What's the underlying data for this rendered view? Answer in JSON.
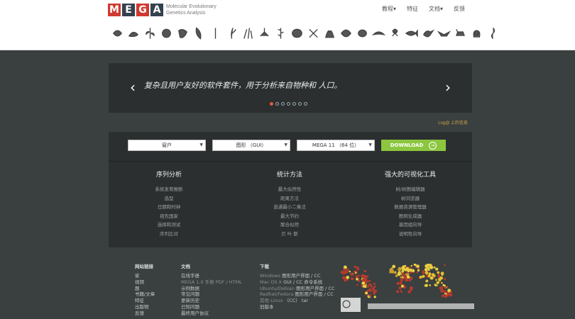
{
  "header": {
    "logo_letters": [
      "M",
      "E",
      "G",
      "A"
    ],
    "logo_subtitle_line1": "Molecular Evolutionary",
    "logo_subtitle_line2": "Genetics Analysis",
    "nav": [
      {
        "label": "教程",
        "has_dropdown": true
      },
      {
        "label": "特征",
        "has_dropdown": false
      },
      {
        "label": "文档",
        "has_dropdown": true
      },
      {
        "label": "反馈",
        "has_dropdown": false
      }
    ],
    "organism_icons": [
      "bacteria-icon",
      "worm-icon",
      "plant-icon",
      "virus-icon",
      "fungus-icon",
      "leaf-icon",
      "seed-icon",
      "sprout-icon",
      "grass-icon",
      "mosquito-icon",
      "wheat-icon",
      "cell-icon",
      "flower-icon",
      "coral-icon",
      "shell-icon",
      "protozoa-icon",
      "nematode-icon",
      "insect-icon",
      "fish-icon",
      "bird-icon",
      "bat-icon",
      "dog-icon",
      "monkey-icon",
      "seahorse-icon"
    ]
  },
  "hero": {
    "text": "复杂且用户友好的软件套件，用于分析来自物种和 人口。",
    "prev_arrow": "‹",
    "next_arrow": "›",
    "slide_count": 7,
    "active_slide": 1
  },
  "login_text": "Log@ 上的信息",
  "download": {
    "os_value": "窗户",
    "interface_value": "图形 （GUI）",
    "version_value": "MEGA 11 （64 位）",
    "button_label": "DOWNLOAD",
    "button_icon": "→"
  },
  "features": [
    {
      "title": "序列分析",
      "items": [
        "系统发育推断",
        "选型",
        "日期和时钟",
        "祖先国家",
        "选择和测试",
        "序列比对"
      ]
    },
    {
      "title": "统计方法",
      "items": [
        "最大似然性",
        "距离方法",
        "普通最小二乘法",
        "最大节约",
        "聚合似然",
        "贝 叶 斯"
      ]
    },
    {
      "title": "强大的可视化工具",
      "items": [
        "树/树图编辑器",
        "树浏览器",
        "数据资源管理器",
        "图例生成器",
        "基因组向导",
        "说明性向导"
      ]
    }
  ],
  "footer": {
    "links": {
      "title": "网站链接",
      "items": [
        "家",
        "视频",
        "题",
        "书籍/文章",
        "特征",
        "出版物",
        "反馈"
      ]
    },
    "docs": {
      "title": "文档",
      "items": [
        {
          "text": "在线手册",
          "muted": false
        },
        {
          "text": "MEGA 1.0 手册 PDF / HTML",
          "muted": true
        },
        {
          "text": "示例数据",
          "muted": false
        },
        {
          "text": "常见问题",
          "muted": false
        },
        {
          "text": "更新历史",
          "muted": false
        },
        {
          "text": "已知问题",
          "muted": false
        },
        {
          "text": "最终用户协议",
          "muted": false
        }
      ]
    },
    "downloads": {
      "title": "下载",
      "items": [
        {
          "os": "Windows",
          "text": "图形用户界面 / CC"
        },
        {
          "os": "Mac OS X",
          "text": "GUI / CC 命令系统"
        },
        {
          "os": "Ubuntu/Debian",
          "text": "图形用户界面 / CC"
        },
        {
          "os": "Redhat/Fedora",
          "text": "图形用户界面 / CC"
        },
        {
          "os": "其他 Linux",
          "text": "（CC） tar"
        },
        {
          "os": "",
          "text": "旧版本"
        }
      ]
    }
  },
  "colors": {
    "background": "#3a3f3f",
    "panel": "#2b2f2f",
    "logo_red": "#cf3a30",
    "logo_dark": "#35414d",
    "download_green": "#8cc63f",
    "active_dot": "#e65a3a"
  }
}
